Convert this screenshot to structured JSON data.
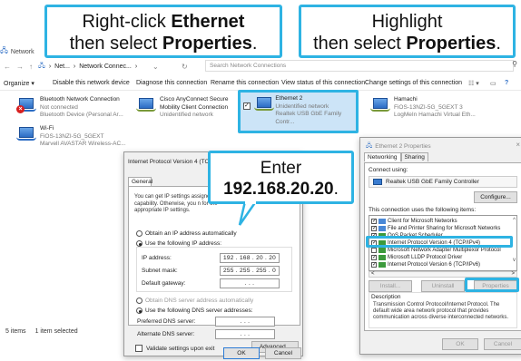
{
  "colors": {
    "accent": "#2eb3e3",
    "selection": "#cce4f7"
  },
  "window": {
    "title": "Network",
    "nav": {
      "back": "←",
      "forward": "→",
      "up": "↑",
      "crumbs": [
        "Net...",
        "Network Connec..."
      ],
      "refresh": "↻",
      "search_placeholder": "Search Network Connections",
      "search_icon": "search-icon"
    },
    "commands": [
      "Organize ▾",
      "Disable this network device",
      "Diagnose this connection",
      "Rename this connection",
      "View status of this connection",
      "Change settings of this connection"
    ]
  },
  "connections": [
    {
      "name": "Bluetooth Network Connection",
      "status": "Not connected",
      "device": "Bluetooth Device (Personal Ar..."
    },
    {
      "name": "Cisco AnyConnect Secure Mobility Client Connection",
      "status": "Unidentified network",
      "device": ""
    },
    {
      "name": "Ethernet 2",
      "status": "Unidentified network",
      "device": "Realtek USB GbE Family Contr..."
    },
    {
      "name": "Hamachi",
      "status": "FiOS-13NZI-5G_5GEXT 3",
      "device": "LogMeIn Hamachi Virtual Eth..."
    },
    {
      "name": "Wi-Fi",
      "status": "FiOS-13NZI-5G_5GEXT",
      "device": "Marvell AVASTAR Wireless-AC..."
    }
  ],
  "status_bar": {
    "items": "5 items",
    "selected": "1 item selected"
  },
  "ipv4": {
    "title": "Internet Protocol Version 4 (TCP/",
    "tab": "General",
    "desc": "You can get IP settings assigned this capability. Otherwise, you n for the appropriate IP settings.",
    "auto_ip": "Obtain an IP address automatically",
    "use_ip": "Use the following IP address:",
    "ip_label": "IP address:",
    "ip_value": "192 . 168 . 20 . 20",
    "mask_label": "Subnet mask:",
    "mask_value": "255 . 255 . 255 . 0",
    "gateway_label": "Default gateway:",
    "gateway_value": ". . .",
    "auto_dns": "Obtain DNS server address automatically",
    "use_dns": "Use the following DNS server addresses:",
    "pref_dns_label": "Preferred DNS server:",
    "pref_dns_value": ". . .",
    "alt_dns_label": "Alternate DNS server:",
    "alt_dns_value": ". . .",
    "validate": "Validate settings upon exit",
    "advanced": "Advanced...",
    "ok": "OK",
    "cancel": "Cancel"
  },
  "eth": {
    "title": "Ethernet 2 Properties",
    "tabs": [
      "Networking",
      "Sharing"
    ],
    "connect_using": "Connect using:",
    "adapter": "Realtek USB GbE Family Controller",
    "configure": "Configure...",
    "items_label": "This connection uses the following items:",
    "items": [
      "Client for Microsoft Networks",
      "File and Printer Sharing for Microsoft Networks",
      "QoS Packet Scheduler",
      "Internet Protocol Version 4 (TCP/IPv4)",
      "Microsoft Network Adapter Multiplexor Protocol",
      "Microsoft LLDP Protocol Driver",
      "Internet Protocol Version 6 (TCP/IPv6)"
    ],
    "install": "Install...",
    "uninstall": "Uninstall",
    "properties": "Properties",
    "description_label": "Description",
    "description": "Transmission Control Protocol/Internet Protocol. The default wide area network protocol that provides communication across diverse interconnected networks.",
    "ok": "OK",
    "cancel": "Cancel"
  },
  "callouts": {
    "left_line1_pre": "Right-click ",
    "left_line1_bold": "Ethernet",
    "left_line2_pre": "then select ",
    "left_line2_bold": "Properties",
    "left_line2_post": ".",
    "right_line1": "Highlight",
    "right_line2_pre": "then select ",
    "right_line2_bold": "Properties",
    "right_line2_post": ".",
    "mid_line1": "Enter",
    "mid_line2_bold": "192.168.20.20",
    "mid_line2_post": "."
  }
}
